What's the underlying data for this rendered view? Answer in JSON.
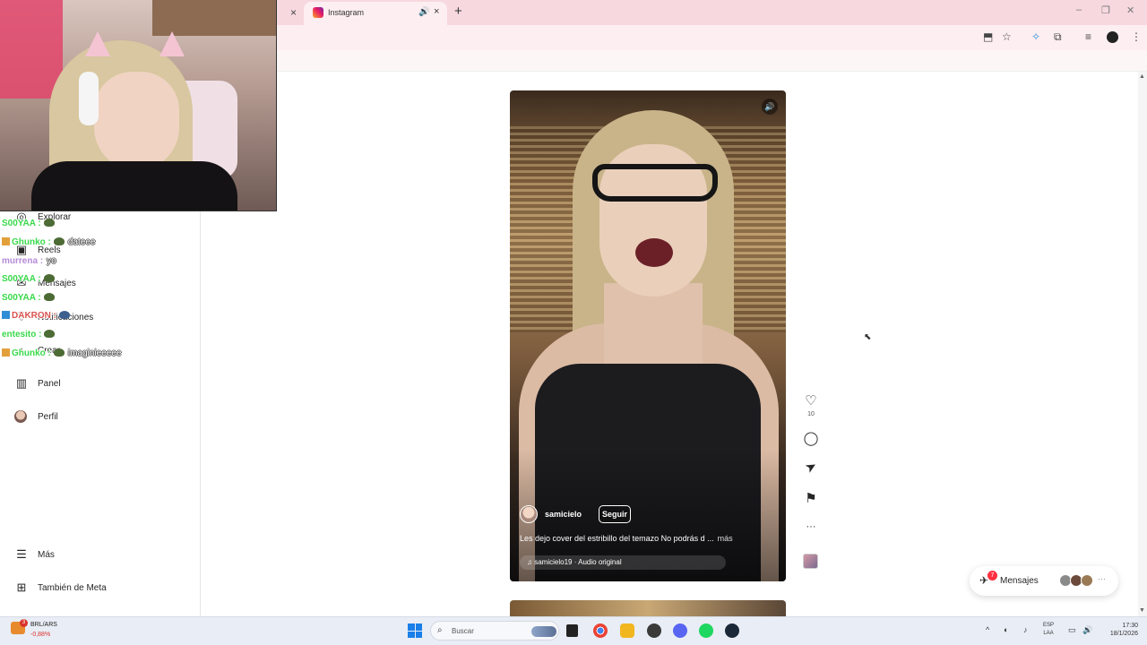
{
  "browser": {
    "tab_title": "Instagram",
    "tab_audio_icon": "speaker-icon",
    "tab_close": "×",
    "prev_tab_close": "×",
    "new_tab": "+",
    "window_controls": [
      "–",
      "❐",
      "✕"
    ],
    "toolbar_icons": [
      "install-icon",
      "star-icon",
      "extension-icon",
      "puzzle-icon",
      "media-icon",
      "profile-icon",
      "menu-icon"
    ]
  },
  "sidebar": {
    "items": [
      {
        "label": "Explorar",
        "icon": "compass-icon"
      },
      {
        "label": "Reels",
        "icon": "reels-icon"
      },
      {
        "label": "Mensajes",
        "icon": "messenger-icon"
      },
      {
        "label": "Notificaciones",
        "icon": "heart-icon"
      },
      {
        "label": "Crear",
        "icon": "plus-icon"
      },
      {
        "label": "Panel",
        "icon": "chart-icon"
      },
      {
        "label": "Perfil",
        "icon": "avatar-icon"
      }
    ],
    "bottom": [
      {
        "label": "Más",
        "icon": "hamburger-icon"
      },
      {
        "label": "También de Meta",
        "icon": "grid-icon"
      }
    ]
  },
  "chat": {
    "lines": [
      {
        "user": "S00YAA :",
        "msg": "",
        "color": "#39d94a",
        "badge": false
      },
      {
        "user": "Ghunko :",
        "msg": "dateee",
        "color": "#39d94a",
        "badge": true
      },
      {
        "user": "murrena :",
        "msg": "yo",
        "color": "#b48ad8",
        "badge": false
      },
      {
        "user": "S00YAA :",
        "msg": "",
        "color": "#39d94a",
        "badge": false
      },
      {
        "user": "S00YAA :",
        "msg": "",
        "color": "#39d94a",
        "badge": false
      },
      {
        "user": "DAKRON :",
        "msg": "",
        "color": "#d9534f",
        "badge": true
      },
      {
        "user": "entesito :",
        "msg": "",
        "color": "#39d94a",
        "badge": false
      },
      {
        "user": "Ghunko :",
        "msg": "imaginieeeee",
        "color": "#39d94a",
        "badge": true
      }
    ]
  },
  "reel": {
    "author": "samicielo",
    "follow_label": "Seguir",
    "caption": "Les dejo cover del estribillo del temazo No podrás d ...",
    "caption_more": "más",
    "audio": "♫ samicielo19 · Audio original",
    "like_count": "10",
    "volume_icon": "🔊"
  },
  "actions": {
    "like": "♡",
    "comment": "◯",
    "share": "➤",
    "save": "⚑",
    "more": "···"
  },
  "messages_pill": {
    "label": "Mensajes",
    "badge": "7",
    "more": "···"
  },
  "taskbar": {
    "stock_name": "BRL/ARS",
    "stock_change": "-0,88%",
    "stock_badge": "3",
    "search_placeholder": "Buscar",
    "lang_1": "ESP",
    "lang_2": "LAA",
    "time": "17:30",
    "date": "18/1/2026"
  }
}
